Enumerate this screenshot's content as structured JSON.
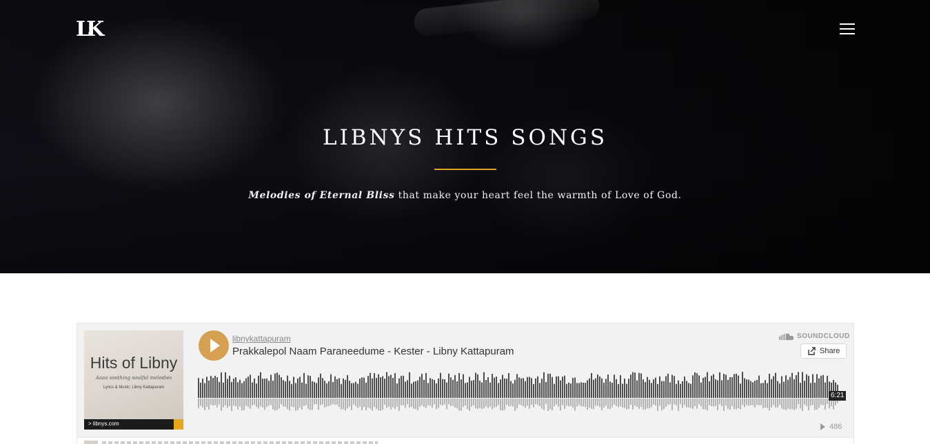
{
  "header": {
    "logo_text": "LK",
    "logo_icon": "lk-monogram-logo",
    "menu_icon": "hamburger-menu-icon"
  },
  "hero": {
    "title": "LIBNYS HITS SONGS",
    "subtitle_emphasis": "Melodies of Eternal Bliss",
    "subtitle_rest": " that make your heart feel the warmth of Love of God.",
    "accent_color": "#e0a526"
  },
  "player": {
    "brand": "SOUNDCLOUD",
    "share_label": "Share",
    "user": "libnykattapuram",
    "track_title": "Prakkalepol Naam Paraneedume - Kester - Libny Kattapuram",
    "duration": "6:21",
    "play_count": "486",
    "play_button_color": "#d5a052",
    "artwork": {
      "title": "Hits of Libny",
      "tagline": "Aaaa soothing soulful melodies",
      "credit": "Lyrics & Music: Libny Kattapuram",
      "site": "> libnys.com"
    }
  }
}
